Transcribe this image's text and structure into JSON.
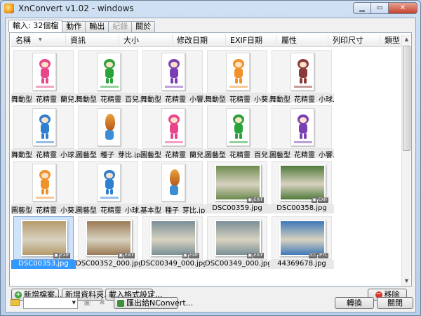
{
  "window": {
    "title": "XnConvert v1.02 - windows",
    "controls": {
      "minimize": "▁",
      "maximize": "▭",
      "close": "✕"
    }
  },
  "tabs": [
    {
      "label": "輸入: 32個檔",
      "active": true,
      "disabled": false
    },
    {
      "label": "動作",
      "active": false,
      "disabled": false
    },
    {
      "label": "輸出",
      "active": false,
      "disabled": false
    },
    {
      "label": "紀錄",
      "active": false,
      "disabled": true
    },
    {
      "label": "關於",
      "active": false,
      "disabled": false
    }
  ],
  "columns": [
    "名稱",
    "資訊",
    "大小",
    "修改日期",
    "EXIF日期",
    "屬性",
    "列印尺寸",
    "類型"
  ],
  "files": [
    {
      "name": "舞動型_花精靈_蘭兒...",
      "kind": "mascot",
      "color": "#e8458b",
      "selected": false,
      "exif": []
    },
    {
      "name": "舞動型_花精靈_百兒...",
      "kind": "mascot",
      "color": "#2aa33a",
      "selected": false,
      "exif": []
    },
    {
      "name": "舞動型_花精靈_小響...",
      "kind": "mascot",
      "color": "#7b3fb3",
      "selected": false,
      "exif": []
    },
    {
      "name": "舞動型_花精靈_小葵...",
      "kind": "mascot",
      "color": "#f0912a",
      "selected": false,
      "exif": []
    },
    {
      "name": "舞動型_花精靈_小球...",
      "kind": "mascot",
      "color": "#8b3a3a",
      "selected": false,
      "exif": []
    },
    {
      "name": "舞動型_花精靈_小球...",
      "kind": "mascot",
      "color": "#2f7fd0",
      "selected": false,
      "exif": []
    },
    {
      "name": "圖藝型_種子_芽比.jpg",
      "kind": "seed",
      "color": "#c46a22",
      "selected": false,
      "exif": []
    },
    {
      "name": "圖藝型_花精靈_蘭兒...",
      "kind": "mascot",
      "color": "#e8458b",
      "selected": false,
      "exif": []
    },
    {
      "name": "圖藝型_花精靈_百兒...",
      "kind": "mascot",
      "color": "#2aa33a",
      "selected": false,
      "exif": []
    },
    {
      "name": "圖藝型_花精靈_小響...",
      "kind": "mascot",
      "color": "#7b3fb3",
      "selected": false,
      "exif": []
    },
    {
      "name": "圖藝型_花精靈_小葵...",
      "kind": "mascot",
      "color": "#f0912a",
      "selected": false,
      "exif": []
    },
    {
      "name": "圖藝型_花精靈_小球...",
      "kind": "mascot",
      "color": "#2f7fd0",
      "selected": false,
      "exif": []
    },
    {
      "name": "基本型_種子_芽比.jpg",
      "kind": "seed",
      "color": "#c46a22",
      "selected": false,
      "exif": []
    },
    {
      "name": "DSC00359.jpg",
      "kind": "photo",
      "color": "#6d8a4e",
      "selected": false,
      "exif": [
        "▣",
        "EXIF"
      ]
    },
    {
      "name": "DSC00358.jpg",
      "kind": "photo",
      "color": "#4f7a3a",
      "selected": false,
      "exif": [
        "▣",
        "EXIF"
      ]
    },
    {
      "name": "DSC00353.jpg",
      "kind": "photo",
      "color": "#b59a6a",
      "selected": true,
      "exif": [
        "▣",
        "EXIF"
      ]
    },
    {
      "name": "DSC00352_000.jpg",
      "kind": "photo",
      "color": "#9b7a55",
      "selected": false,
      "exif": [
        "▣",
        "EXIF"
      ]
    },
    {
      "name": "DSC00349_000.jpg_o...",
      "kind": "photo",
      "color": "#7a8f96",
      "selected": false,
      "exif": [
        "▣",
        "EXIF"
      ]
    },
    {
      "name": "DSC00349_000.jpg",
      "kind": "photo",
      "color": "#7a8f96",
      "selected": false,
      "exif": [
        "▣",
        "EXIF"
      ]
    },
    {
      "name": "44369678.jpg",
      "kind": "photo",
      "color": "#3e78b8",
      "selected": false,
      "exif": [
        "ICC",
        "IPTC"
      ]
    }
  ],
  "buttons": {
    "add_files": "新增檔案...",
    "add_folder": "新增資料夾...",
    "import_settings": "載入格式設定...",
    "remove": "移除",
    "export": "匯出給NConvert...",
    "convert": "轉換",
    "close": "關閉"
  }
}
